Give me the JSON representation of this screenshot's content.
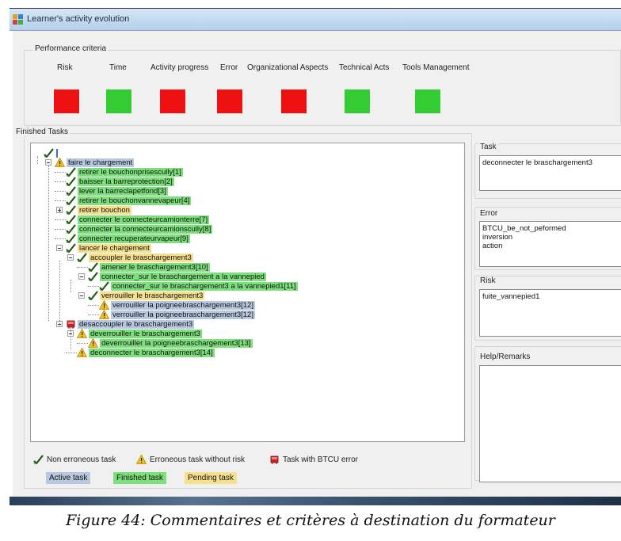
{
  "window": {
    "title": "Learner's activity evolution"
  },
  "performance": {
    "group_label": "Performance criteria",
    "criteria": [
      {
        "label": "Risk",
        "status_color": "#ee1111"
      },
      {
        "label": "Time",
        "status_color": "#33cc33"
      },
      {
        "label": "Activity progress",
        "status_color": "#ee1111"
      },
      {
        "label": "Error",
        "status_color": "#ee1111"
      },
      {
        "label": "Organizational Aspects",
        "status_color": "#ee1111"
      },
      {
        "label": "Technical Acts",
        "status_color": "#33cc33"
      },
      {
        "label": "Tools Management",
        "status_color": "#33cc33"
      }
    ]
  },
  "tasks": {
    "group_label": "Finished Tasks",
    "nodes": [
      {
        "label": "",
        "icon": "check-icon",
        "state": "none"
      },
      {
        "label": "faire le chargement",
        "icon": "warning-icon",
        "state": "active"
      },
      {
        "label": "retirer le bouchonprisescully[1]",
        "icon": "check-icon",
        "state": "finished"
      },
      {
        "label": "baisser la barreprotection[2]",
        "icon": "check-icon",
        "state": "finished"
      },
      {
        "label": "lever la barreclapetfond[3]",
        "icon": "check-icon",
        "state": "finished"
      },
      {
        "label": "retirer le bouchonvannevapeur[4]",
        "icon": "check-icon",
        "state": "finished"
      },
      {
        "label": "retirer bouchon",
        "icon": "check-icon",
        "state": "pending"
      },
      {
        "label": "connecter le connecteurcamionterre[7]",
        "icon": "check-icon",
        "state": "finished"
      },
      {
        "label": "connecter la connecteurcamionscully[8]",
        "icon": "check-icon",
        "state": "finished"
      },
      {
        "label": "connecter recuperateurvapeur[9]",
        "icon": "check-icon",
        "state": "finished"
      },
      {
        "label": "lancer le chargement",
        "icon": "check-icon",
        "state": "pending"
      },
      {
        "label": "accoupler le braschargement3",
        "icon": "check-icon",
        "state": "pending"
      },
      {
        "label": "amener le braschargement3[10]",
        "icon": "check-icon",
        "state": "finished"
      },
      {
        "label": "connecter_sur le braschargement a la vannepied",
        "icon": "check-icon",
        "state": "finished"
      },
      {
        "label": "connecter_sur le braschargement3 a la vannepied1[11]",
        "icon": "check-icon",
        "state": "finished"
      },
      {
        "label": "verrouiller le braschargement3",
        "icon": "check-icon",
        "state": "pending"
      },
      {
        "label": "verrouiller la poigneebraschargement3[12]",
        "icon": "warning-icon",
        "state": "active"
      },
      {
        "label": "verrouiller la poigneebraschargement3[12]",
        "icon": "warning-icon",
        "state": "active"
      },
      {
        "label": "desaccoupler le braschargement3",
        "icon": "btcu-error-icon",
        "state": "active"
      },
      {
        "label": "deverrouiller le braschargement3",
        "icon": "warning-icon",
        "state": "finished"
      },
      {
        "label": "deverrouiller la poigneebraschargement3[13]",
        "icon": "warning-icon",
        "state": "finished"
      },
      {
        "label": "deconnecter le braschargement3[14]",
        "icon": "warning-icon",
        "state": "finished"
      }
    ]
  },
  "legend": {
    "non_erroneous": "Non erroneous task",
    "erroneous_no_risk": "Erroneous task without risk",
    "btcu_error": "Task with BTCU error",
    "active": "Active task",
    "finished": "Finished task",
    "pending": "Pending task"
  },
  "colors": {
    "active": "#b7c8e0",
    "finished": "#7de07d",
    "pending": "#f6e08f",
    "red": "#ee1111",
    "green": "#33cc33"
  },
  "task_panel": {
    "label": "Task",
    "value": "deconnecter le braschargement3"
  },
  "error_panel": {
    "label": "Error",
    "items": [
      "BTCU_be_not_peformed",
      "inversion",
      "action"
    ]
  },
  "risk_panel": {
    "label": "Risk",
    "items": [
      "fuite_vannepied1"
    ]
  },
  "help_panel": {
    "label": "Help/Remarks",
    "value": ""
  },
  "caption": "Figure 44: Commentaires et critères à destination du formateur"
}
